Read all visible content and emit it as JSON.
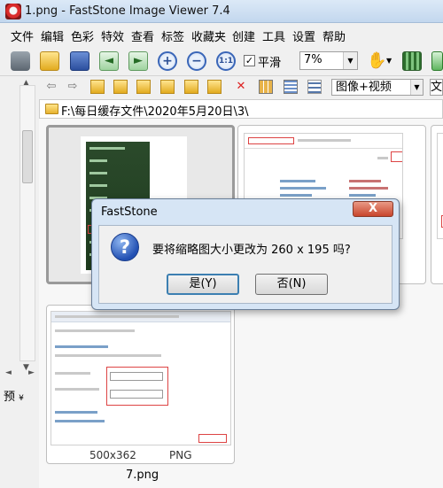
{
  "window": {
    "title": "1.png - FastStone Image Viewer 7.4"
  },
  "menu": [
    "文件",
    "编辑",
    "色彩",
    "特效",
    "查看",
    "标签",
    "收藏夹",
    "创建",
    "工具",
    "设置",
    "帮助"
  ],
  "toolbar": {
    "smooth_label": "平滑",
    "smooth_checked": "✓",
    "zoom_value": "7%",
    "zoom_in": "+",
    "zoom_out": "−",
    "actual_size": "1:1",
    "prev_arrow": "◄",
    "next_arrow": "►"
  },
  "browser": {
    "view_mode": "图像+视频",
    "view_mode2": "文",
    "path": "F:\\每日缓存文件\\2020年5月20日\\3\\"
  },
  "left_panel": {
    "preview_tab": "预"
  },
  "thumbnails": [
    {
      "name": "",
      "dimensions": "",
      "format": ""
    },
    {
      "name": "",
      "dimensions": "",
      "format": ""
    },
    {
      "name": "7.png",
      "dimensions": "500x362",
      "format": "PNG"
    }
  ],
  "dialog": {
    "title": "FastStone",
    "message": "要将缩略图大小更改为 260 x 195 吗?",
    "yes_label": "是(Y)",
    "no_label": "否(N)",
    "close_label": "X"
  },
  "colors": {
    "titlebar": "#c3d7ee",
    "dialog_frame": "#d6e5f5",
    "close_button": "#c8452c",
    "selected_thumb": "#9a9a9a"
  }
}
